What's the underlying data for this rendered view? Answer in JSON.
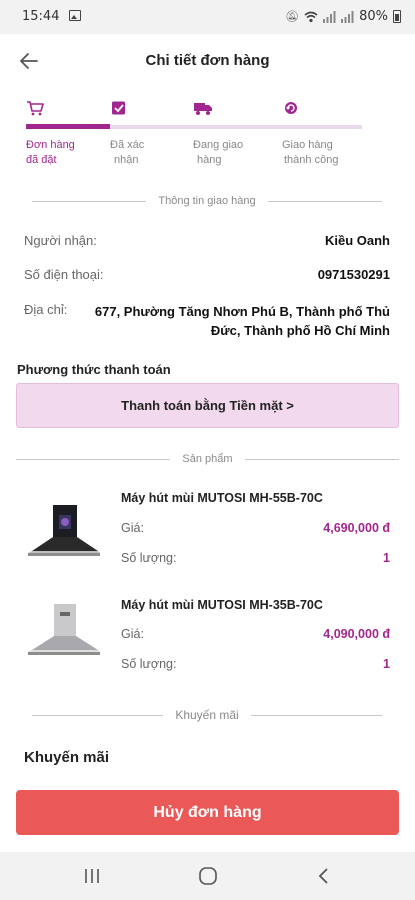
{
  "status_bar": {
    "time": "15:44",
    "battery": "80%"
  },
  "header": {
    "title": "Chi tiết đơn hàng"
  },
  "steps": [
    {
      "label_line1": "Đơn hàng",
      "label_line2": "đã đặt",
      "icon": "cart-icon",
      "active": true
    },
    {
      "label_line1": "Đã xác",
      "label_line2": "nhận",
      "icon": "checkbox-icon",
      "active": false
    },
    {
      "label_line1": "Đang giao",
      "label_line2": "hàng",
      "icon": "truck-icon",
      "active": false
    },
    {
      "label_line1": "Giao hàng",
      "label_line2": "thành công",
      "icon": "refresh-icon",
      "active": false
    }
  ],
  "progress_fraction": 0.25,
  "shipping": {
    "section_label": "Thông tin giao hàng",
    "recipient_label": "Người nhận:",
    "recipient_value": "Kiều Oanh",
    "phone_label": "Số điện thoại:",
    "phone_value": "0971530291",
    "address_label": "Địa chỉ:",
    "address_line1": "677, Phường Tăng Nhơn Phú B, Thành phố Thủ",
    "address_line2": "Đức, Thành phố Hồ Chí Minh"
  },
  "payment": {
    "title": "Phương thức thanh toán",
    "button_label": "Thanh toán bằng Tiền mặt >"
  },
  "products_section_label": "Sản phẩm",
  "products": [
    {
      "name": "Máy hút mùi MUTOSI MH-55B-70C",
      "price_label": "Giá:",
      "price": "4,690,000 đ",
      "qty_label": "Số lượng:",
      "qty": "1",
      "finish": "black"
    },
    {
      "name": "Máy hút mùi MUTOSI MH-35B-70C",
      "price_label": "Giá:",
      "price": "4,090,000 đ",
      "qty_label": "Số lượng:",
      "qty": "1",
      "finish": "silver"
    }
  ],
  "promo": {
    "section_label": "Khuyến mãi",
    "title": "Khuyến mãi"
  },
  "cancel_button_label": "Hủy đơn hàng",
  "colors": {
    "accent": "#a2268f",
    "cancel": "#eb5858",
    "payment_bg": "#f2d9ee"
  }
}
